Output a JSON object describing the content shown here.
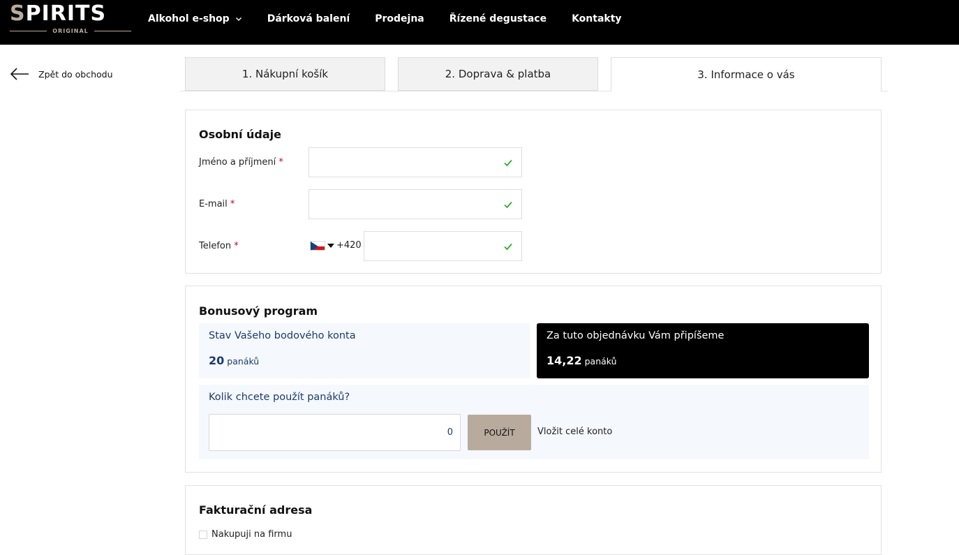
{
  "brand": {
    "name_first": "S",
    "name_rest": "PIRITS",
    "sub": "ORIGINAL"
  },
  "nav": {
    "items": [
      {
        "label": "Alkohol e-shop"
      },
      {
        "label": "Dárková balení"
      },
      {
        "label": "Prodejna"
      },
      {
        "label": "Řízené degustace"
      },
      {
        "label": "Kontakty"
      }
    ]
  },
  "back": {
    "label": "Zpět do obchodu"
  },
  "steps": [
    {
      "label": "1. Nákupní košík"
    },
    {
      "label": "2. Doprava & platba"
    },
    {
      "label": "3. Informace o vás"
    }
  ],
  "personal": {
    "title": "Osobní údaje",
    "name_label": "Jméno a příjmení",
    "email_label": "E-mail",
    "phone_label": "Telefon",
    "required_mark": "*",
    "phone_prefix": "+420"
  },
  "bonus": {
    "title": "Bonusový program",
    "balance_label": "Stav Vašeho bodového konta",
    "balance_value": "20",
    "balance_unit": "panáků",
    "earn_label": "Za tuto objednávku Vám připíšeme",
    "earn_value": "14,22",
    "earn_unit": "panáků",
    "use_question": "Kolik chcete použít panáků?",
    "use_value": "0",
    "use_button": "POUŽÍT",
    "use_all": "Vložit celé konto"
  },
  "billing": {
    "title": "Fakturační adresa",
    "company_label": "Nakupuji na firmu"
  },
  "colors": {
    "accent": "#b8ab9d",
    "blue": "#1b3b6f",
    "success": "#2bb02b"
  }
}
